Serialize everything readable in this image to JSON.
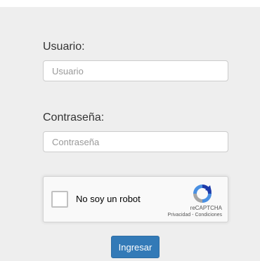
{
  "form": {
    "user_label": "Usuario:",
    "user_placeholder": "Usuario",
    "user_value": "",
    "password_label": "Contraseña:",
    "password_placeholder": "Contraseña",
    "password_value": "",
    "submit_label": "Ingresar"
  },
  "captcha": {
    "checkbox_label": "No soy un robot",
    "brand": "reCAPTCHA",
    "privacy_link": "Privacidad",
    "separator": " - ",
    "terms_link": "Condiciones",
    "logo_icon": "recaptcha-logo-icon"
  },
  "colors": {
    "panel_background": "#eeeeee",
    "button_primary": "#337ab7"
  }
}
